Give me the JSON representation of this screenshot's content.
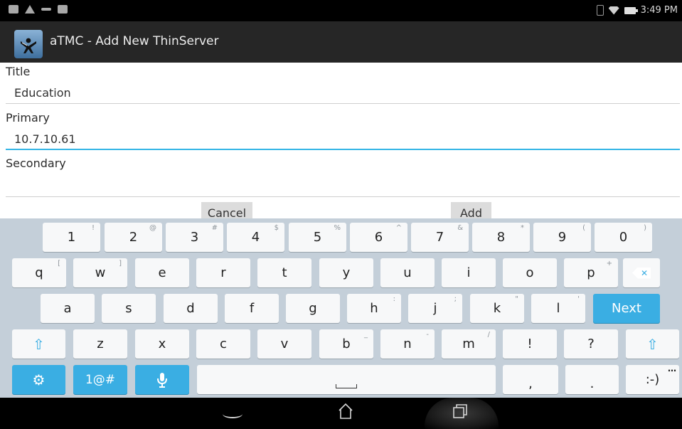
{
  "status_bar": {
    "time": "3:49 PM",
    "left_icons": [
      "notification-icon",
      "warning-icon",
      "usb-icon",
      "clipboard-icon"
    ],
    "right_icons": [
      "battery-icon",
      "wifi-icon",
      "battery-charging-icon"
    ]
  },
  "app": {
    "title": "aTMC - Add New ThinServer",
    "icon": "atmc-logo-icon"
  },
  "form": {
    "title_label": "Title",
    "title_value": "Education",
    "primary_label": "Primary",
    "primary_value": "10.7.10.61",
    "secondary_label": "Secondary",
    "secondary_value": "",
    "cancel_label": "Cancel",
    "add_label": "Add"
  },
  "keyboard": {
    "row1": [
      {
        "k": "1",
        "s": "!"
      },
      {
        "k": "2",
        "s": "@"
      },
      {
        "k": "3",
        "s": "#"
      },
      {
        "k": "4",
        "s": "$"
      },
      {
        "k": "5",
        "s": "%"
      },
      {
        "k": "6",
        "s": "^"
      },
      {
        "k": "7",
        "s": "&"
      },
      {
        "k": "8",
        "s": "*"
      },
      {
        "k": "9",
        "s": "("
      },
      {
        "k": "0",
        "s": ")"
      }
    ],
    "row2": [
      {
        "k": "q",
        "s": "["
      },
      {
        "k": "w",
        "s": "]"
      },
      {
        "k": "e",
        "s": ""
      },
      {
        "k": "r",
        "s": ""
      },
      {
        "k": "t",
        "s": ""
      },
      {
        "k": "y",
        "s": ""
      },
      {
        "k": "u",
        "s": ""
      },
      {
        "k": "i",
        "s": ""
      },
      {
        "k": "o",
        "s": ""
      },
      {
        "k": "p",
        "s": "+"
      }
    ],
    "row3": [
      {
        "k": "a",
        "s": ""
      },
      {
        "k": "s",
        "s": ""
      },
      {
        "k": "d",
        "s": ""
      },
      {
        "k": "f",
        "s": ""
      },
      {
        "k": "g",
        "s": ""
      },
      {
        "k": "h",
        "s": ":"
      },
      {
        "k": "j",
        "s": ";"
      },
      {
        "k": "k",
        "s": "\""
      },
      {
        "k": "l",
        "s": "'"
      }
    ],
    "row4": [
      {
        "k": "z",
        "s": ""
      },
      {
        "k": "x",
        "s": ""
      },
      {
        "k": "c",
        "s": ""
      },
      {
        "k": "v",
        "s": ""
      },
      {
        "k": "b",
        "s": "_"
      },
      {
        "k": "n",
        "s": "-"
      },
      {
        "k": "m",
        "s": "/"
      },
      {
        "k": "!",
        "s": ""
      },
      {
        "k": "?",
        "s": ""
      }
    ],
    "next_label": "Next",
    "symbols_label": "1@#",
    "comma_label": ",",
    "period_label": ".",
    "emoticon_label": ":-)",
    "emoticon_more": "…",
    "shift_glyph": "⇧",
    "backspace_glyph": "✕",
    "settings_glyph": "⚙",
    "accent_color": "#3aaee3"
  },
  "nav_bar": {
    "icons": [
      "back-icon",
      "home-icon",
      "recent-apps-icon"
    ]
  }
}
